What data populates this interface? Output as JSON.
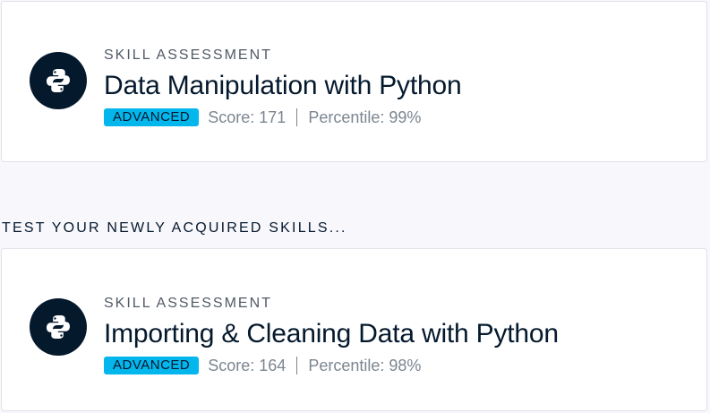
{
  "colors": {
    "page_background": "#f7f7fc",
    "card_background": "#ffffff",
    "navy": "#05192d",
    "badge_blue": "#03b6ec",
    "muted_text": "#7c8591"
  },
  "cards": [
    {
      "icon": "python-logo-icon",
      "eyebrow": "SKILL ASSESSMENT",
      "title": "Data Manipulation with Python",
      "badge": "ADVANCED",
      "score": "Score: 171",
      "percentile": "Percentile: 99%"
    },
    {
      "icon": "python-logo-icon",
      "eyebrow": "SKILL ASSESSMENT",
      "title": "Importing & Cleaning Data with Python",
      "badge": "ADVANCED",
      "score": "Score: 164",
      "percentile": "Percentile: 98%"
    }
  ],
  "section_heading": "TEST YOUR NEWLY ACQUIRED SKILLS..."
}
